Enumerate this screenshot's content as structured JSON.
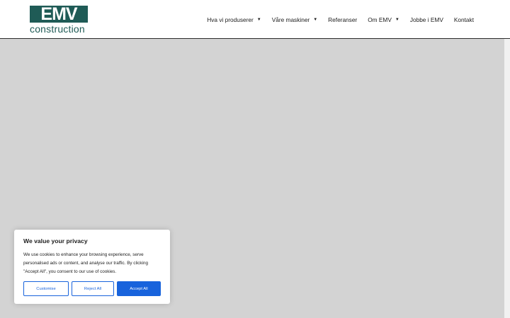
{
  "logo": {
    "main": "EMV",
    "sub": "construction"
  },
  "nav": [
    {
      "label": "Hva vi produserer",
      "dropdown": true
    },
    {
      "label": "Våre maskiner",
      "dropdown": true
    },
    {
      "label": "Referanser",
      "dropdown": false
    },
    {
      "label": "Om EMV",
      "dropdown": true
    },
    {
      "label": "Jobbe i EMV",
      "dropdown": false
    },
    {
      "label": "Kontakt",
      "dropdown": false
    }
  ],
  "cookie": {
    "title": "We value your privacy",
    "text": "We use cookies to enhance your browsing experience, serve personalised ads or content, and analyse our traffic. By clicking \"Accept All\", you consent to our use of cookies.",
    "customise": "Customise",
    "reject": "Reject All",
    "accept": "Accept All"
  },
  "colors": {
    "brand": "#1f5b56",
    "accent": "#1863dc",
    "background": "#d3d3d3"
  }
}
